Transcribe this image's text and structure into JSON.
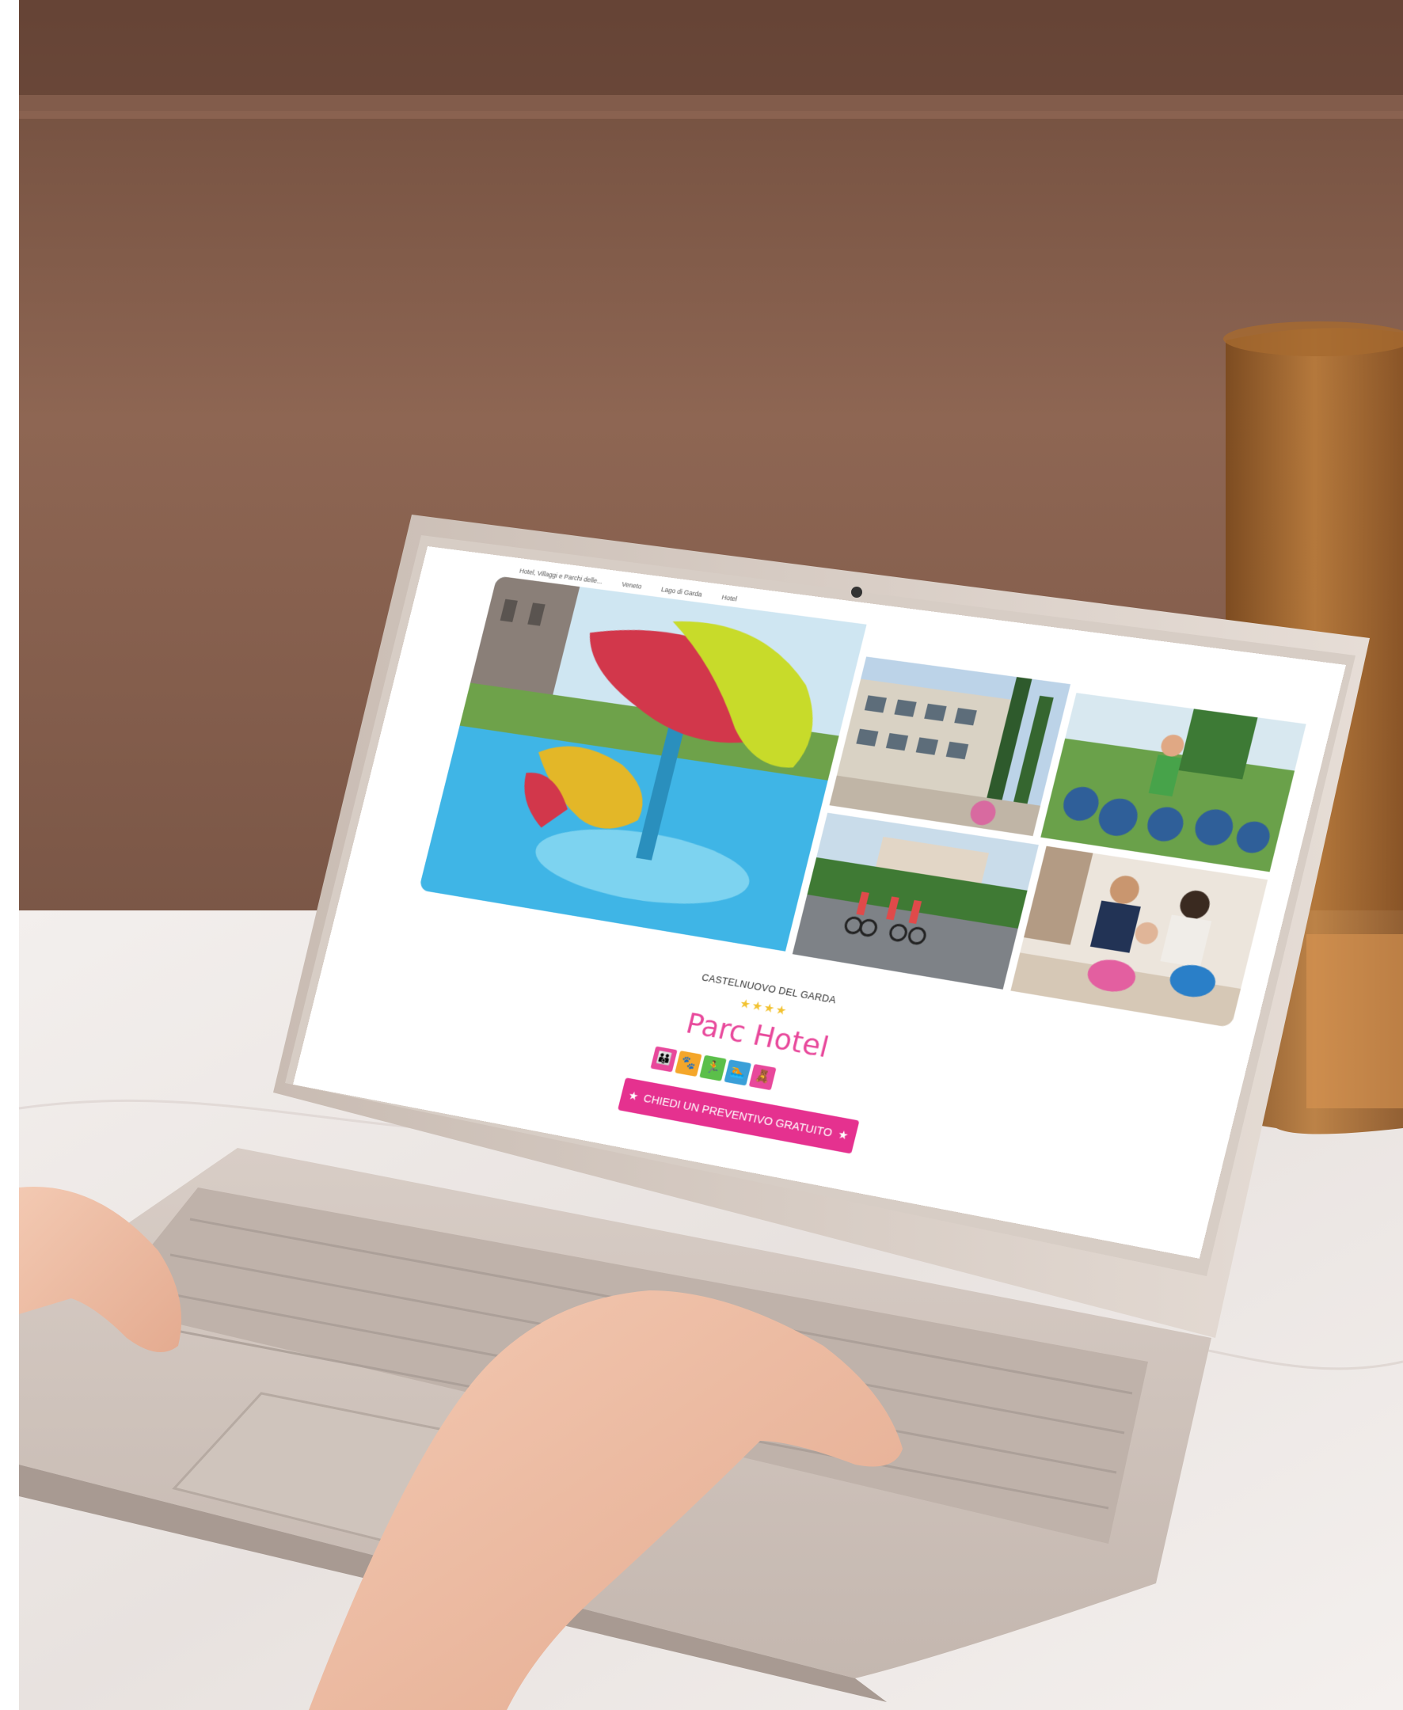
{
  "breadcrumb": [
    "Hotel, Villaggi e Parchi delle...",
    "Veneto",
    "Lago di Garda",
    "Hotel"
  ],
  "hotel": {
    "location": "CASTELNUOVO DEL GARDA",
    "stars": "★★★★",
    "name": "Parc Hotel"
  },
  "amenities": [
    {
      "icon": "family-icon",
      "glyph": "👪",
      "color": "#e8489b"
    },
    {
      "icon": "pet-icon",
      "glyph": "🐾",
      "color": "#f4a62a"
    },
    {
      "icon": "activity-icon",
      "glyph": "🏃",
      "color": "#5bbf4a"
    },
    {
      "icon": "pool-icon",
      "glyph": "🏊",
      "color": "#3a9fd8"
    },
    {
      "icon": "kids-icon",
      "glyph": "🧸",
      "color": "#e8489b"
    }
  ],
  "cta": {
    "star_left": "★",
    "label": "CHIEDI UN PREVENTIVO GRATUITO",
    "star_right": "★"
  }
}
